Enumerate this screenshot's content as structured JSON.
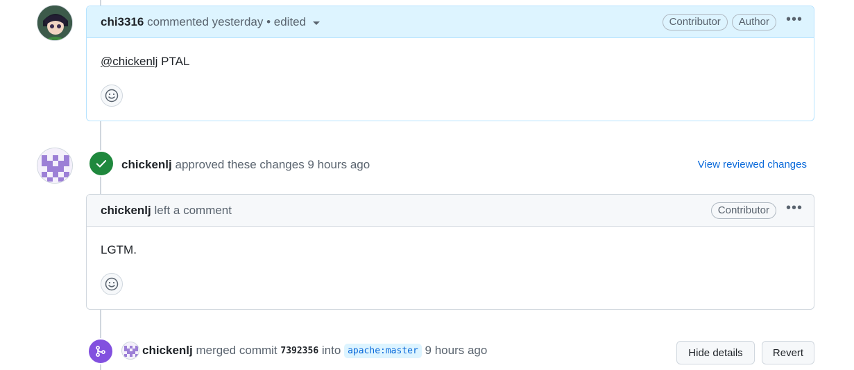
{
  "comment1": {
    "author": "chi3316",
    "meta": "commented yesterday • edited",
    "badges": [
      "Contributor",
      "Author"
    ],
    "mention": "@chickenlj",
    "body_text": " PTAL"
  },
  "review": {
    "author": "chickenlj",
    "action": "approved these changes 9 hours ago",
    "link": "View reviewed changes"
  },
  "comment2": {
    "author": "chickenlj",
    "meta": "left a comment",
    "badge": "Contributor",
    "body": "LGTM."
  },
  "merge": {
    "author": "chickenlj",
    "text1": "merged commit",
    "commit": "7392356",
    "text2": "into",
    "branch": "apache:master",
    "time": "9 hours ago",
    "hide_label": "Hide details",
    "revert_label": "Revert"
  },
  "colors": {
    "header_blue": "#ddf4ff",
    "border_blue": "#b6e3ff",
    "approved_green": "#1f883d",
    "merged_purple": "#8250df",
    "link_blue": "#0969da"
  },
  "icons": [
    "avatar-chi3316",
    "avatar-chickenlj",
    "dropdown-caret-icon",
    "kebab-icon",
    "smiley-icon",
    "check-icon",
    "merge-icon"
  ]
}
